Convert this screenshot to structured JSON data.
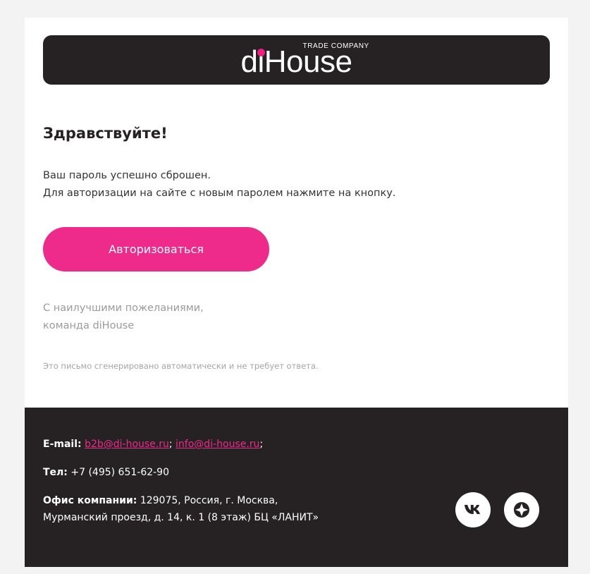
{
  "header": {
    "logo_di": "di",
    "logo_house": "House",
    "logo_tagline": "TRADE COMPANY"
  },
  "content": {
    "greeting": "Здравствуйте!",
    "line1": "Ваш пароль успешно сброшен.",
    "line2": "Для авторизации на сайте с новым паролем нажмите на кнопку.",
    "button_label": "Авторизоваться",
    "signoff1": "С наилучшими пожеланиями,",
    "signoff2": "команда diHouse",
    "auto_note": "Это письмо сгенерировано автоматически и не требует ответа."
  },
  "footer": {
    "email_label": "E-mail:",
    "email1": "b2b@di-house.ru",
    "email_sep": ";",
    "email2": "info@di-house.ru",
    "email_end": ";",
    "phone_label": "Тел:",
    "phone": "+7 (495) 651-62-90",
    "office_label": "Офис компании:",
    "office_line1": "129075, Россия, г. Москва,",
    "office_line2": "Мурманский проезд, д. 14, к. 1 (8 этаж) БЦ «ЛАНИТ»"
  },
  "social": {
    "vk_icon": "vk-icon",
    "other_icon": "compass-icon"
  },
  "colors": {
    "brand_pink": "#ee2a8a",
    "dark": "#262223",
    "background": "#f3f3f3"
  }
}
